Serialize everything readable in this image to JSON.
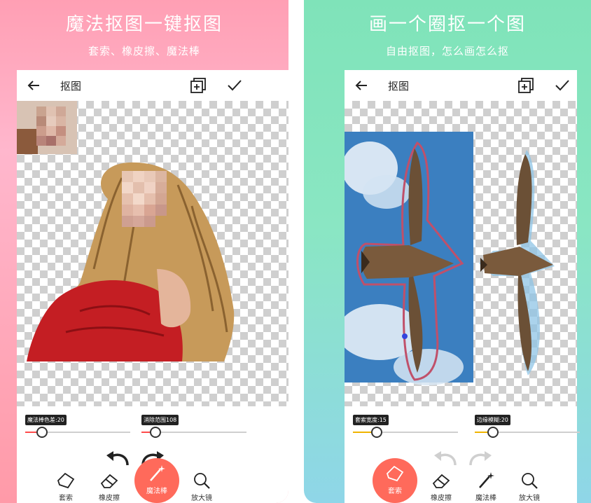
{
  "left_panel": {
    "headline": "魔法抠图一键抠图",
    "subline": "套索、橡皮擦、魔法棒",
    "screen": {
      "title": "抠图",
      "sliders": [
        {
          "label": "魔法棒色差:20",
          "value": 20,
          "color": "#ff4b4b"
        },
        {
          "label": "消除范围108",
          "value": 108,
          "color": "#ff4b4b"
        }
      ],
      "tools": [
        {
          "label": "套索",
          "icon": "lasso-icon"
        },
        {
          "label": "橡皮擦",
          "icon": "eraser-icon"
        },
        {
          "label": "魔法棒",
          "icon": "magic-wand-icon",
          "active": true
        },
        {
          "label": "放大镜",
          "icon": "magnifier-icon"
        }
      ]
    }
  },
  "right_panel": {
    "headline": "画一个圈抠一个图",
    "subline": "自由抠图，怎么画怎么抠",
    "screen": {
      "title": "抠图",
      "sliders": [
        {
          "label": "套索宽度:15",
          "value": 15,
          "color": "#f0b400"
        },
        {
          "label": "边缘模糊:20",
          "value": 20,
          "color": "#f0b400"
        }
      ],
      "tools": [
        {
          "label": "套索",
          "icon": "lasso-icon",
          "active": true
        },
        {
          "label": "橡皮擦",
          "icon": "eraser-icon"
        },
        {
          "label": "魔法棒",
          "icon": "magic-wand-icon"
        },
        {
          "label": "放大镜",
          "icon": "magnifier-icon"
        }
      ]
    }
  },
  "colors": {
    "left_accent": "#ff9aa8",
    "right_accent": "#7fe3b9",
    "active_tool": "#ff6a5b"
  }
}
